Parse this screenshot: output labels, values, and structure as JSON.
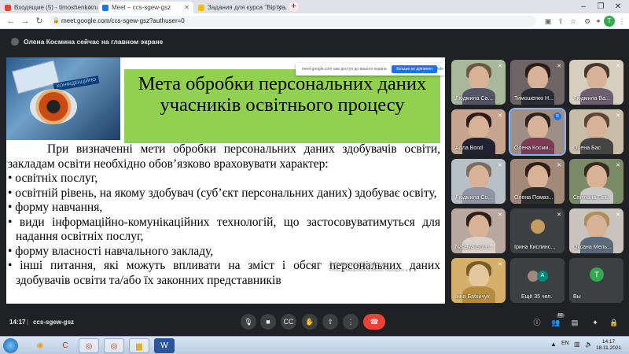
{
  "browser": {
    "tabs": [
      {
        "label": "Входящие (5) - timoshenko.nata...",
        "color": "#ea4335"
      },
      {
        "label": "Meet – ccs-sgew-gsz",
        "color": "#1a73e8"
      },
      {
        "label": "Задания для курса \"Віртуальна ...",
        "color": "#fbbc04"
      }
    ],
    "new_tab": "+",
    "url": "meet.google.com/ccs-sgew-gsz?authuser=0",
    "profile_initial": "Т"
  },
  "meet": {
    "presenter_note": "Олена Космина сейчас на главном экране",
    "share_popup": {
      "text": "meet.google.com нав доступ до вашого екрана",
      "button": "Більше не діяпинен",
      "hide": "Hide"
    },
    "slide": {
      "image_tag": "КОНФІДЕНЦІЙНО",
      "title": "Мета обробки персональних даних учасників освітнього процесу",
      "intro": "При визначенні мети обробки персональних даних здобувачів освіти, закладам освіти необхідно обов’язково враховувати характер:",
      "bullets": [
        "•  освітніх послуг,",
        "•  освітній рівень, на якому здобувач (суб’єкт персональних даних) здобуває освіту,",
        "•  форму навчання,",
        "• види інформаційно-комунікаційних технологій, що застосовуватимуться для надання освітніх послуг,",
        "• форму власності навчального закладу,",
        "• інші питання, які можуть впливати на зміст і обсяг персональних даних здобувачів освіти та/або їх законних представників"
      ],
      "watermark_title": "Активация Windows",
      "watermark_sub": "Чтобы активировать Windows, перейдите в"
    },
    "participants": [
      {
        "name": "Людмила Са...",
        "bg": "#a9b89a",
        "hair": "#6b5a40"
      },
      {
        "name": "Тимошенко Н...",
        "bg": "#6e6466",
        "hair": "#2b1c16"
      },
      {
        "name": "Людмила Ва...",
        "bg": "#d6cfc0",
        "hair": "#4a3a2e"
      },
      {
        "name": "Алла Bond",
        "bg": "#c7a48f",
        "hair": "#2a1c18"
      },
      {
        "name": "Олена Косми...",
        "bg": "#9d8e86",
        "hair": "#2d241f"
      },
      {
        "name": "Олена Бас",
        "bg": "#c8bda9",
        "hair": "#5b4634"
      },
      {
        "name": "Людмила Со...",
        "bg": "#b7c0c6",
        "hair": "#7c6d5f"
      },
      {
        "name": "Олена Помаз...",
        "bg": "#a38a78",
        "hair": "#2f1f17"
      },
      {
        "name": "Світлана Пет...",
        "bg": "#7a8a66",
        "hair": "#3a2a1e"
      },
      {
        "name": "Natalya Ghuri...",
        "bg": "#b8a89f",
        "hair": "#2c1e17"
      },
      {
        "name": "Ірина Кислинс...",
        "bg": "#3c4043",
        "hair": "#c49c62"
      },
      {
        "name": "Оксана Мель...",
        "bg": "#c9c5be",
        "hair": "#b18d5c"
      },
      {
        "name": "Інна Бабійчук",
        "bg": "#d4b06a",
        "hair": "#7a5b2a"
      },
      {
        "name": "Ещё 35 чел.",
        "bg": "#3c4043"
      },
      {
        "name": "Вы",
        "bg": "#3c4043",
        "initial": "T"
      }
    ],
    "more_initial": "A",
    "controls": {
      "time": "14:17",
      "separator": "|",
      "meeting_code": "ccs-sgew-gsz",
      "people_count": "50"
    }
  },
  "taskbar": {
    "lang": "EN",
    "time": "14:17",
    "date": "18.11.2021"
  }
}
